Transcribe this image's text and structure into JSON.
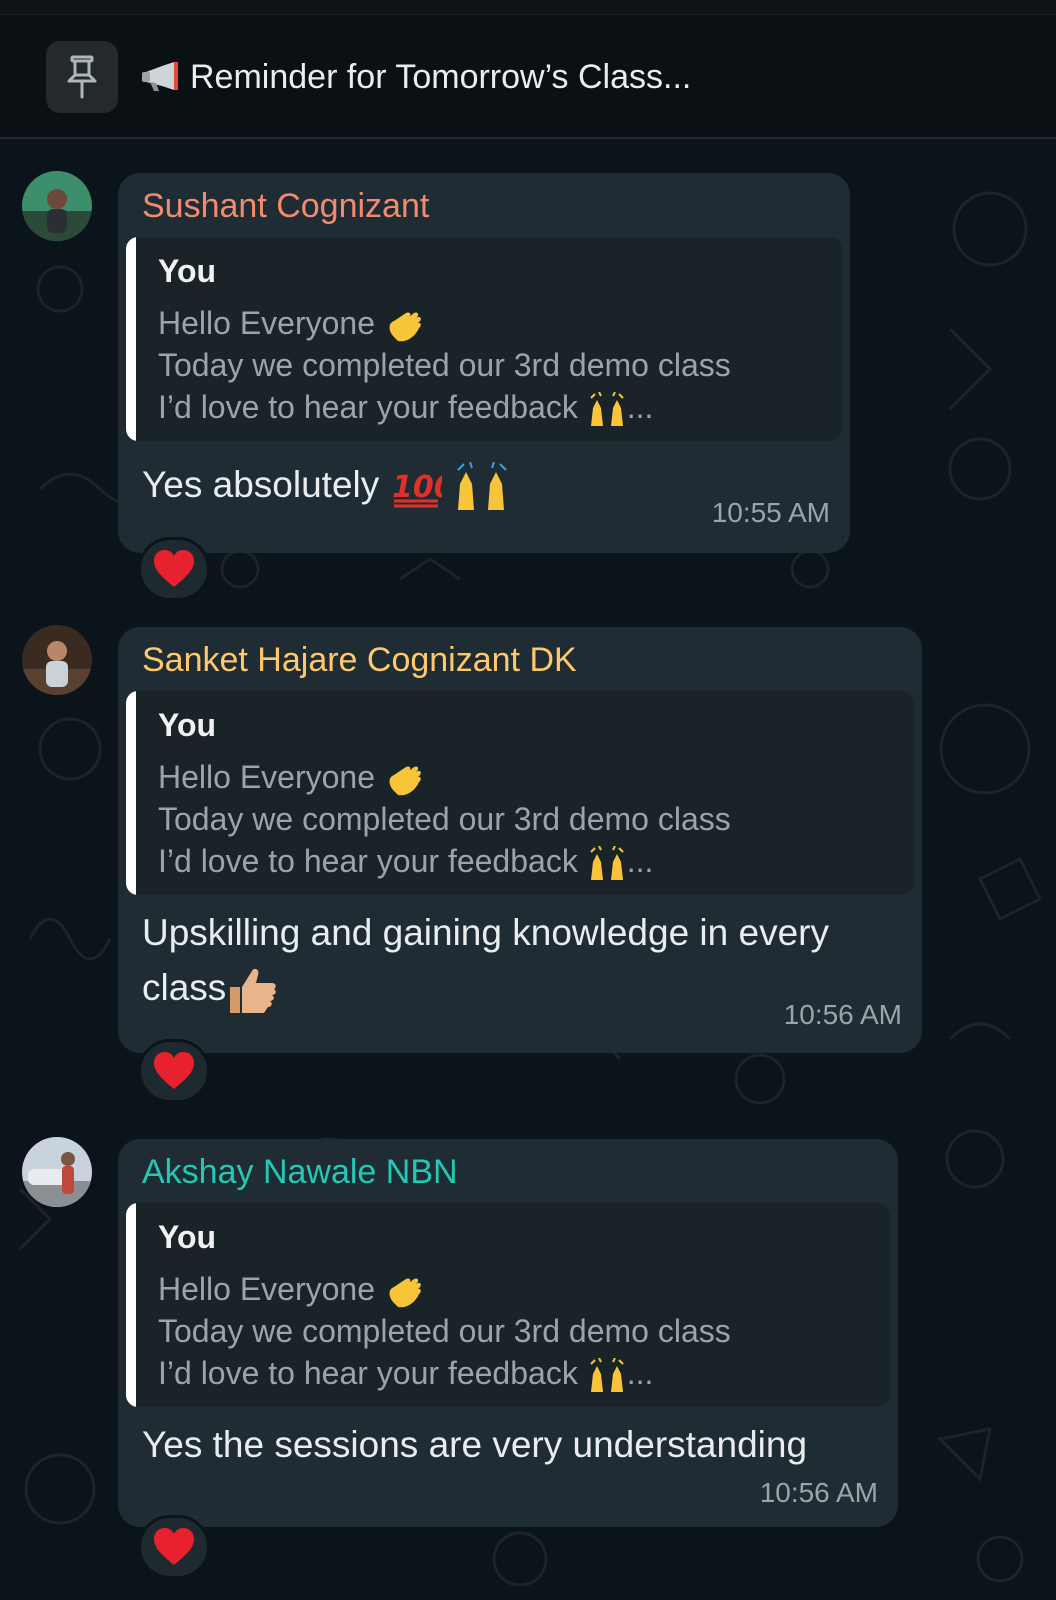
{
  "pinned": {
    "icon": "pin-icon",
    "announcement_icon": "megaphone-icon",
    "text": "Reminder for Tomorrow’s Class..."
  },
  "quoted": {
    "author": "You",
    "line1": "Hello Everyone",
    "line1_emoji": "waving-hand-emoji",
    "line2": "Today we completed our 3rd demo class",
    "line3": "I’d love to hear your feedback",
    "line3_emoji": "raising-hands-emoji",
    "ellipsis": "..."
  },
  "messages": [
    {
      "sender": "Sushant Cognizant",
      "sender_color": "#f28b6e",
      "text": "Yes absolutely",
      "emojis": [
        "hundred-points-emoji",
        "raising-hands-emoji"
      ],
      "time": "10:55 AM",
      "reaction": "red-heart-emoji"
    },
    {
      "sender": "Sanket Hajare Cognizant DK",
      "sender_color": "#ffc96b",
      "text_line1": "Upskilling and gaining knowledge in every",
      "text_line2": "class",
      "emojis": [
        "thumbs-up-emoji"
      ],
      "time": "10:56 AM",
      "reaction": "red-heart-emoji"
    },
    {
      "sender": "Akshay Nawale NBN",
      "sender_color": "#25c7b5",
      "text": "Yes the sessions are very understanding",
      "time": "10:56 AM",
      "reaction": "red-heart-emoji"
    }
  ]
}
